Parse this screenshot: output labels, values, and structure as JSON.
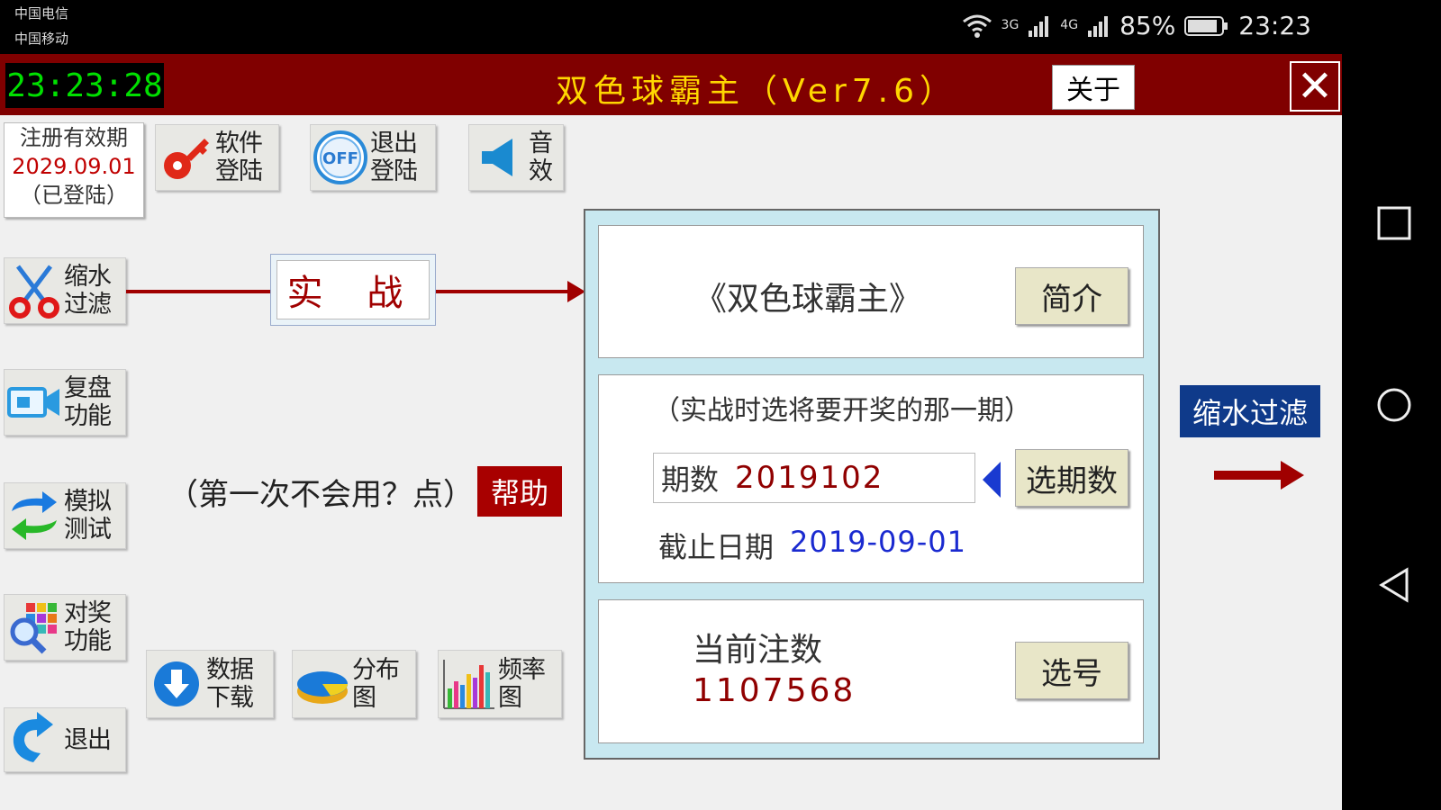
{
  "status_bar": {
    "carrier1": "中国电信",
    "carrier2": "中国移动",
    "signal1": "3G",
    "signal2": "4G",
    "battery": "85%",
    "time": "23:23"
  },
  "app": {
    "clock": "23:23:28",
    "title": "双色球霸主（Ver7.6）",
    "about_label": "关于",
    "close_label": "✕"
  },
  "registration": {
    "line1": "注册有效期",
    "date": "2029.09.01",
    "status": "（已登陆）"
  },
  "top_buttons": [
    {
      "line1": "软件",
      "line2": "登陆"
    },
    {
      "icon_text": "OFF",
      "line1": "退出",
      "line2": "登陆"
    },
    {
      "line1": "音",
      "line2": "效"
    }
  ],
  "side_buttons": [
    {
      "line1": "缩水",
      "line2": "过滤"
    },
    {
      "line1": "复盘",
      "line2": "功能"
    },
    {
      "line1": "模拟",
      "line2": "测试"
    },
    {
      "line1": "对奖",
      "line2": "功能"
    },
    {
      "line1": "退出",
      "line2": ""
    }
  ],
  "bottom_buttons": [
    {
      "line1": "数据",
      "line2": "下载"
    },
    {
      "line1": "分布",
      "line2": "图"
    },
    {
      "line1": "频率",
      "line2": "图"
    }
  ],
  "shizhan_label": "实 战",
  "help": {
    "text": "（第一次不会用？点）",
    "button": "帮助"
  },
  "panel": {
    "intro_title": "《双色球霸主》",
    "intro_button": "简介",
    "hint": "（实战时选将要开奖的那一期）",
    "issue_label": "期数",
    "issue_value": "2019102",
    "select_issue_button": "选期数",
    "deadline_label": "截止日期",
    "deadline_value": "2019-09-01",
    "count_label": "当前注数",
    "count_value": "1107568",
    "select_number_button": "选号"
  },
  "right": {
    "filter_button": "缩水过滤"
  },
  "colors": {
    "title_bar": "#800000",
    "clock_text": "#00e000",
    "title_text": "#ffd700",
    "accent_red": "#a00000",
    "accent_blue": "#0f3a8a"
  }
}
